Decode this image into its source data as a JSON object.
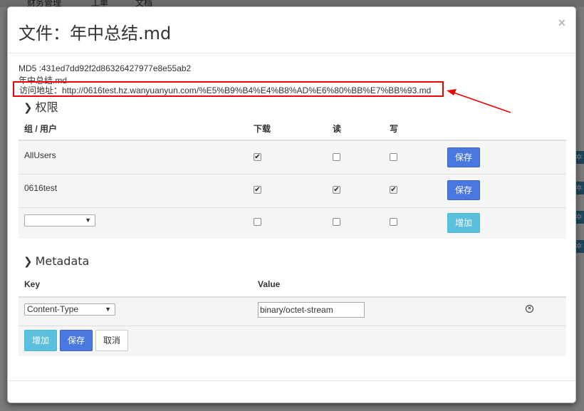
{
  "background": {
    "tabs": [
      "财务管理",
      "工单",
      "文档"
    ],
    "gear_icon": "gear-icon"
  },
  "modal": {
    "title": "文件：年中总结.md",
    "close_icon": "×",
    "md5": "MD5 :431ed7dd92f2d86326427977e8e55ab2",
    "filename": "年中总结.md",
    "url": "访问地址：http://0616test.hz.wanyuanyun.com/%E5%B9%B4%E4%B8%AD%E6%80%BB%E7%BB%93.md",
    "highlight_color": "#e00000"
  },
  "permissions": {
    "title": "权限",
    "headers": {
      "group": "组 / 用户",
      "download": "下载",
      "read": "读",
      "write": "写"
    },
    "rows": [
      {
        "name": "AllUsers",
        "download": true,
        "read": false,
        "write": false,
        "button": "保存"
      },
      {
        "name": "0616test",
        "download": true,
        "read": true,
        "write": true,
        "button": "保存"
      }
    ],
    "new_row": {
      "select_value": "",
      "download": false,
      "read": false,
      "write": false,
      "button": "增加"
    }
  },
  "metadata": {
    "title": "Metadata",
    "headers": {
      "key": "Key",
      "value": "Value"
    },
    "rows": [
      {
        "key": "Content-Type",
        "value": "binary/octet-stream",
        "remove_icon": "remove-circle-icon"
      }
    ],
    "buttons": {
      "add": "增加",
      "save": "保存",
      "cancel": "取消"
    }
  },
  "colors": {
    "primary": "#4a78e0",
    "info": "#5bc0de"
  }
}
